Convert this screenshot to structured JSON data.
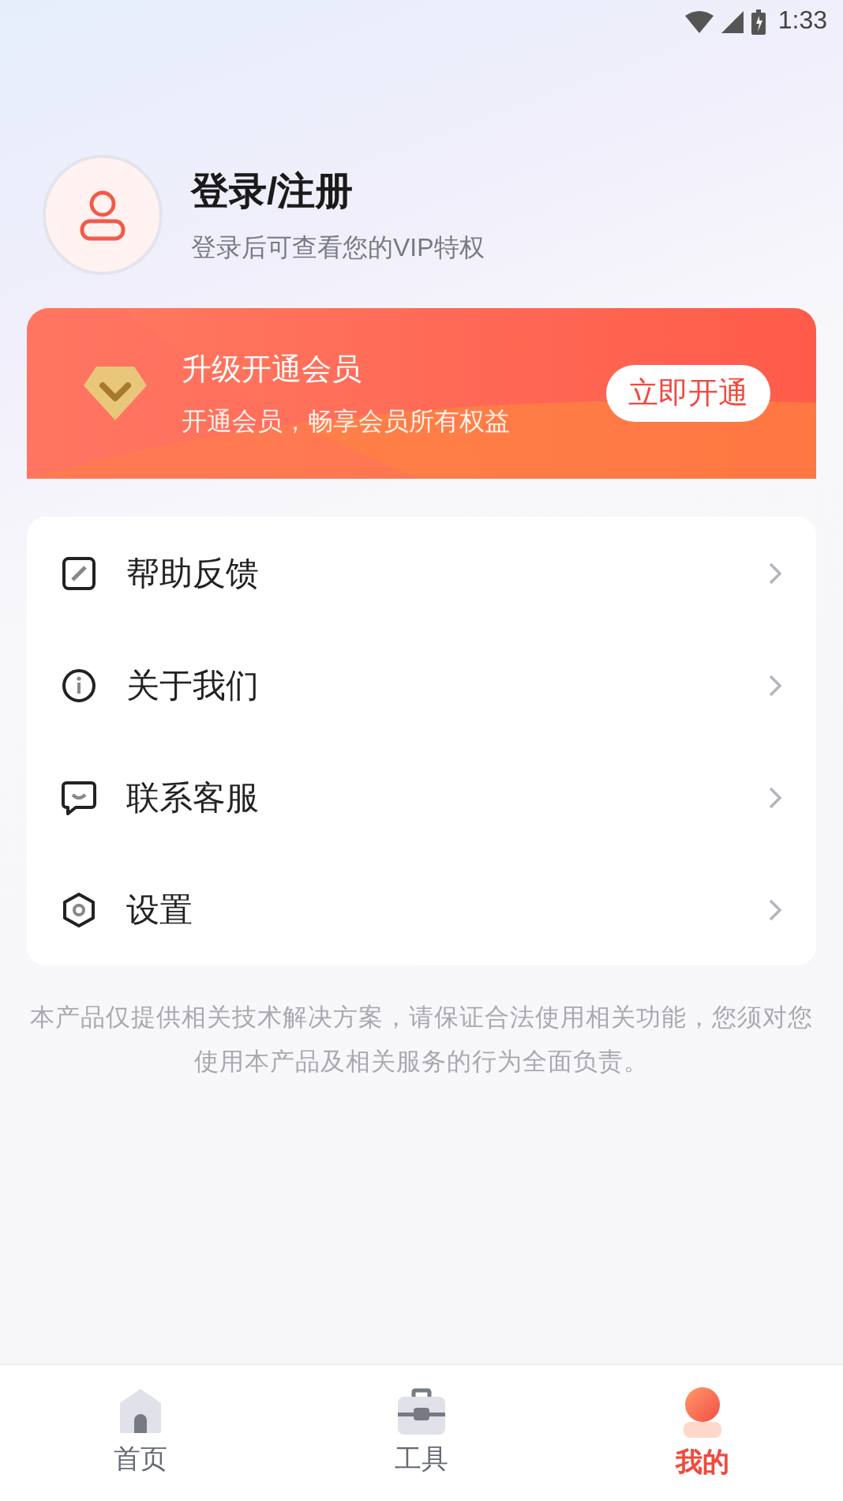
{
  "status_bar": {
    "time": "1:33"
  },
  "profile": {
    "title": "登录/注册",
    "subtitle": "登录后可查看您的VIP特权"
  },
  "vip_banner": {
    "title": "升级开通会员",
    "subtitle": "开通会员，畅享会员所有权益",
    "button": "立即开通"
  },
  "menu": [
    {
      "kind": "feedback",
      "label": "帮助反馈"
    },
    {
      "kind": "about",
      "label": "关于我们"
    },
    {
      "kind": "contact",
      "label": "联系客服"
    },
    {
      "kind": "settings",
      "label": "设置"
    }
  ],
  "disclaimer": "本产品仅提供相关技术解决方案，请保证合法使用相关功能，您须对您使用本产品及相关服务的行为全面负责。",
  "tabs": [
    {
      "kind": "home",
      "label": "首页",
      "selected": false
    },
    {
      "kind": "tools",
      "label": "工具",
      "selected": false
    },
    {
      "kind": "mine",
      "label": "我的",
      "selected": true
    }
  ]
}
